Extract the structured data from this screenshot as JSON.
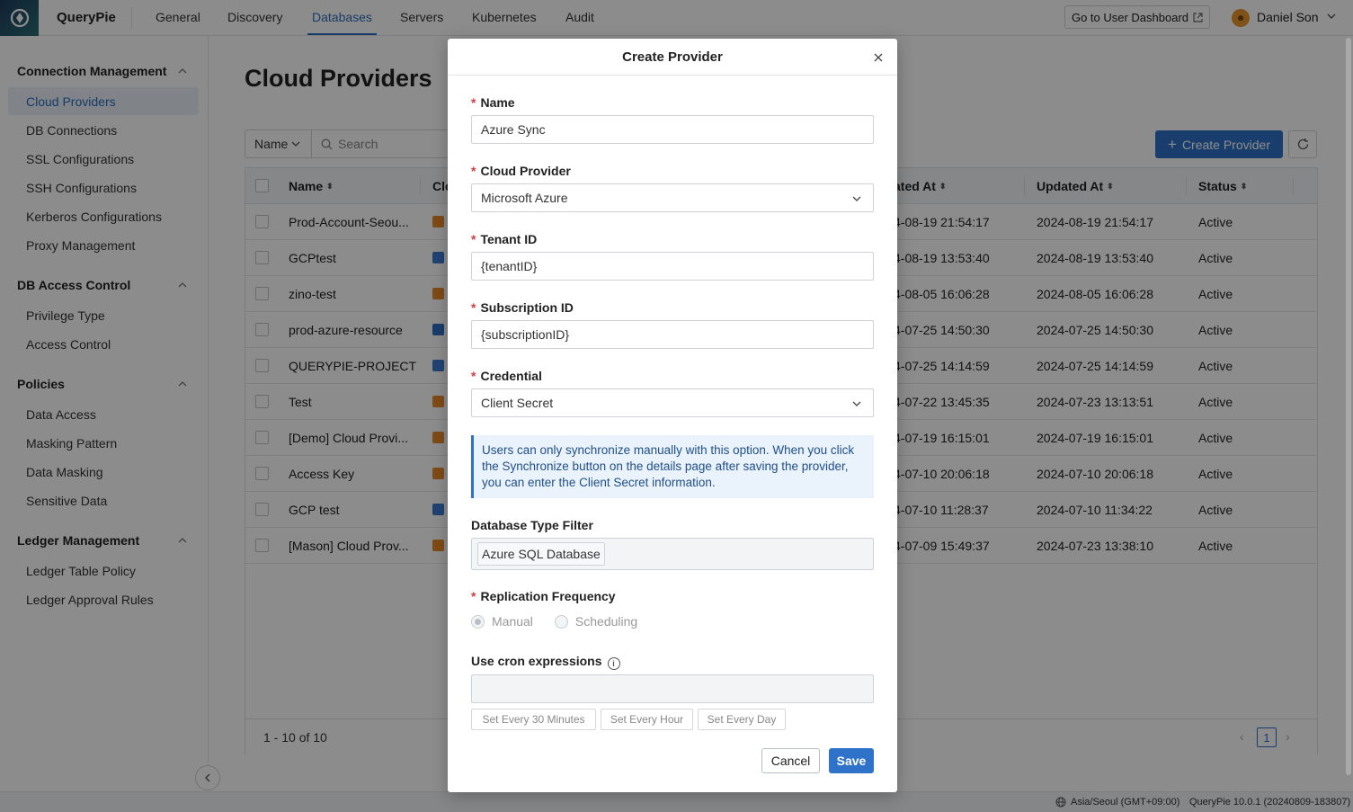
{
  "app": {
    "brand": "QueryPie"
  },
  "nav": {
    "items": [
      "General",
      "Discovery",
      "Databases",
      "Servers",
      "Kubernetes",
      "Audit"
    ],
    "active": "Databases",
    "dashboard_button": "Go to User Dashboard",
    "user_name": "Daniel Son"
  },
  "sidebar": {
    "groups": [
      {
        "label": "Connection Management",
        "items": [
          "Cloud Providers",
          "DB Connections",
          "SSL Configurations",
          "SSH Configurations",
          "Kerberos Configurations",
          "Proxy Management"
        ]
      },
      {
        "label": "DB Access Control",
        "items": [
          "Privilege Type",
          "Access Control"
        ]
      },
      {
        "label": "Policies",
        "items": [
          "Data Access",
          "Masking Pattern",
          "Data Masking",
          "Sensitive Data"
        ]
      },
      {
        "label": "Ledger Management",
        "items": [
          "Ledger Table Policy",
          "Ledger Approval Rules"
        ]
      }
    ],
    "active_item": "Cloud Providers"
  },
  "main": {
    "title": "Cloud Providers",
    "filter_select": "Name",
    "search_placeholder": "Search",
    "create_button": "Create Provider",
    "table": {
      "columns": {
        "name": "Name",
        "cloud": "Clo",
        "created": "ated At",
        "updated": "Updated At",
        "status": "Status"
      },
      "rows": [
        {
          "name": "Prod-Account-Seou...",
          "provider": "aws",
          "created": "4-08-19 21:54:17",
          "updated": "2024-08-19 21:54:17",
          "status": "Active"
        },
        {
          "name": "GCPtest",
          "provider": "gcp",
          "created": "4-08-19 13:53:40",
          "updated": "2024-08-19 13:53:40",
          "status": "Active"
        },
        {
          "name": "zino-test",
          "provider": "aws",
          "created": "4-08-05 16:06:28",
          "updated": "2024-08-05 16:06:28",
          "status": "Active"
        },
        {
          "name": "prod-azure-resource",
          "provider": "azure",
          "created": "4-07-25 14:50:30",
          "updated": "2024-07-25 14:50:30",
          "status": "Active"
        },
        {
          "name": "QUERYPIE-PROJECT",
          "provider": "gcp",
          "created": "4-07-25 14:14:59",
          "updated": "2024-07-25 14:14:59",
          "status": "Active"
        },
        {
          "name": "Test",
          "provider": "aws",
          "created": "4-07-22 13:45:35",
          "updated": "2024-07-23 13:13:51",
          "status": "Active"
        },
        {
          "name": "[Demo] Cloud Provi...",
          "provider": "aws",
          "created": "4-07-19 16:15:01",
          "updated": "2024-07-19 16:15:01",
          "status": "Active"
        },
        {
          "name": "Access Key",
          "provider": "aws",
          "created": "4-07-10 20:06:18",
          "updated": "2024-07-10 20:06:18",
          "status": "Active"
        },
        {
          "name": "GCP test",
          "provider": "gcp",
          "created": "4-07-10 11:28:37",
          "updated": "2024-07-10 11:34:22",
          "status": "Active"
        },
        {
          "name": "[Mason] Cloud Prov...",
          "provider": "aws",
          "created": "4-07-09 15:49:37",
          "updated": "2024-07-23 13:38:10",
          "status": "Active"
        }
      ],
      "footer_count": "1 - 10 of 10",
      "current_page": "1"
    }
  },
  "modal": {
    "title": "Create Provider",
    "name_label": "Name",
    "name_value": "Azure Sync",
    "cloud_label": "Cloud Provider",
    "cloud_value": "Microsoft Azure",
    "tenant_label": "Tenant ID",
    "tenant_value": "{tenantID}",
    "subscription_label": "Subscription ID",
    "subscription_value": "{subscriptionID}",
    "credential_label": "Credential",
    "credential_value": "Client Secret",
    "info_text": "Users can only synchronize manually with this option. When you click the Synchronize button on the details page after saving the provider, you can enter the Client Secret information.",
    "db_filter_label": "Database Type Filter",
    "db_filter_tag": "Azure SQL Database",
    "replication_label": "Replication Frequency",
    "replication_options": [
      "Manual",
      "Scheduling"
    ],
    "cron_label": "Use cron expressions",
    "presets": [
      "Set Every 30 Minutes",
      "Set Every Hour",
      "Set Every Day"
    ],
    "cancel": "Cancel",
    "save": "Save"
  },
  "statusbar": {
    "timezone": "Asia/Seoul (GMT+09:00)",
    "version": "QueryPie 10.0.1 (20240809-183807)"
  },
  "colors": {
    "accent": "#2f72c9",
    "required": "#d63b3b",
    "aws": "#e8892b",
    "gcp": "#3b7bd4",
    "azure": "#2f6fc4"
  }
}
